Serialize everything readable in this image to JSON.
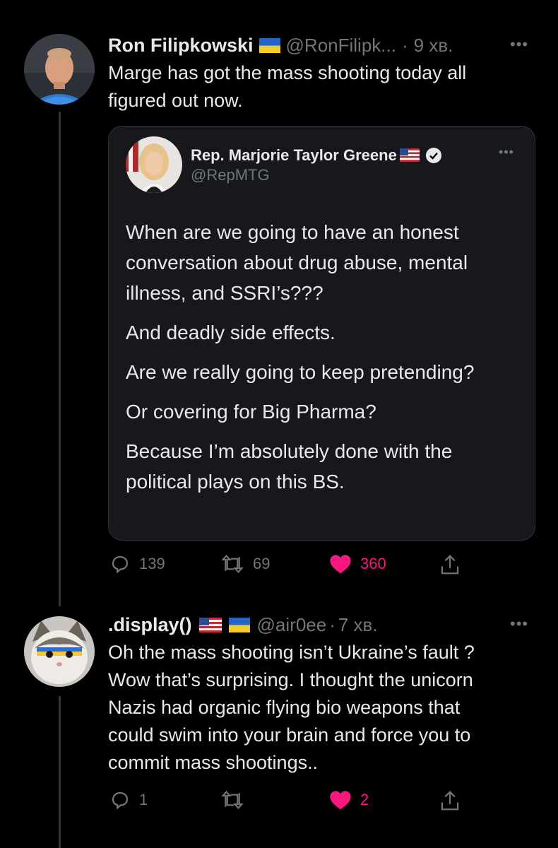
{
  "tweet1": {
    "name": "Ron Filipkowski",
    "handle": "@RonFilipk...",
    "separator": "·",
    "time": "9 хв.",
    "text_line1": "Marge has got the mass shooting today all",
    "text_line2": "figured out now.",
    "flag_icon": "ukraine-flag"
  },
  "quote": {
    "name": "Rep. Marjorie Taylor Greene",
    "handle": "@RepMTG",
    "paragraphs": [
      "When are we going to have an honest conversation about drug abuse, mental illness, and SSRI’s???",
      "And deadly side effects.",
      "Are we really going to keep pretending?",
      "Or covering for Big Pharma?",
      "Because I’m absolutely done with the political plays on this BS."
    ],
    "badges": [
      "us-flag",
      "verified-badge"
    ]
  },
  "actions1": {
    "replies": "139",
    "retweets": "69",
    "likes": "360"
  },
  "tweet2": {
    "name": ".display()",
    "handle": "@air0ee",
    "separator": "·",
    "time": "7 хв.",
    "lines": [
      "Oh the mass shooting isn’t Ukraine’s fault ?",
      "Wow that’s surprising. I thought the unicorn",
      "Nazis had organic flying bio weapons that",
      "could swim into your brain and force you to",
      "commit mass shootings.."
    ]
  },
  "actions2": {
    "replies": "1",
    "retweets": "",
    "likes": "2"
  },
  "colors": {
    "background": "#000000",
    "text": "#e7e9ea",
    "muted": "#71767b",
    "like": "#f91880",
    "card": "#16181c"
  }
}
